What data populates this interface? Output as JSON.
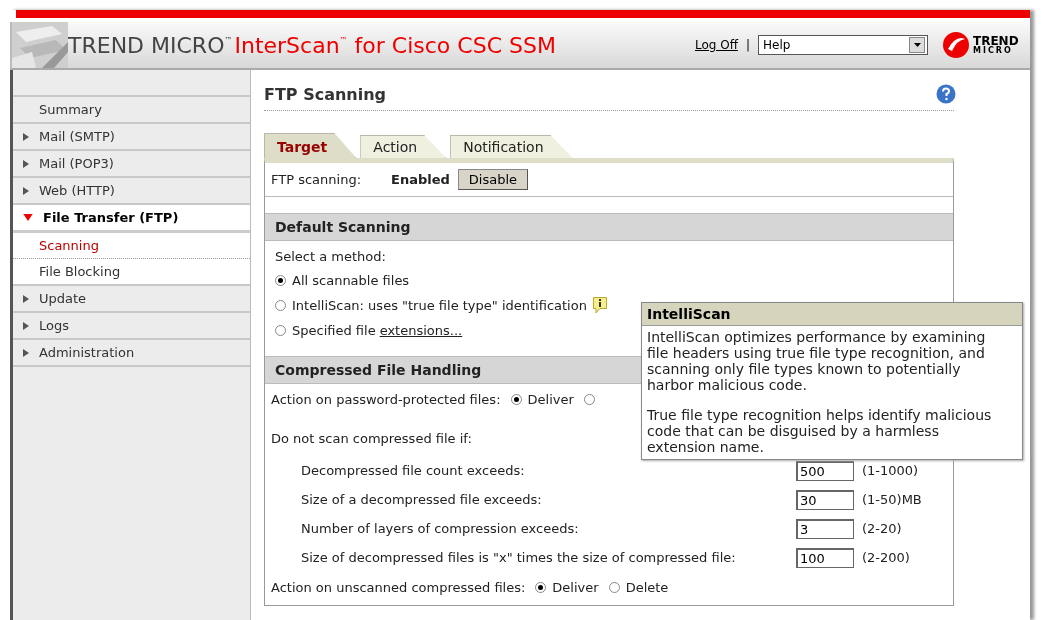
{
  "header": {
    "brand": "TREND MICRO",
    "brand_mark": "™",
    "product": "InterScan",
    "product_mark": "™",
    "product_suffix": "for Cisco CSC SSM",
    "logoff": "Log Off",
    "separator": "|",
    "help_select": {
      "value": "Help"
    },
    "logo_text": "TREND",
    "logo_subtext": "MICRO"
  },
  "sidebar": {
    "items": [
      {
        "label": "Summary",
        "kind": "plain",
        "expanded": false
      },
      {
        "label": "Mail (SMTP)",
        "kind": "section",
        "expanded": false
      },
      {
        "label": "Mail (POP3)",
        "kind": "section",
        "expanded": false
      },
      {
        "label": "Web (HTTP)",
        "kind": "section",
        "expanded": false
      },
      {
        "label": "File Transfer (FTP)",
        "kind": "section",
        "expanded": true,
        "children": [
          {
            "label": "Scanning",
            "selected": true
          },
          {
            "label": "File Blocking",
            "selected": false
          }
        ]
      },
      {
        "label": "Update",
        "kind": "section",
        "expanded": false
      },
      {
        "label": "Logs",
        "kind": "section",
        "expanded": false
      },
      {
        "label": "Administration",
        "kind": "section",
        "expanded": false
      }
    ]
  },
  "content": {
    "title": "FTP Scanning",
    "tabs": [
      {
        "label": "Target",
        "selected": true
      },
      {
        "label": "Action",
        "selected": false
      },
      {
        "label": "Notification",
        "selected": false
      }
    ],
    "status": {
      "label": "FTP scanning:",
      "value": "Enabled",
      "button": "Disable"
    },
    "default_scanning": {
      "heading": "Default Scanning",
      "prompt": "Select a method:",
      "options": [
        {
          "label": "All scannable files",
          "selected": true,
          "kind": "plain"
        },
        {
          "label": "IntelliScan: uses \"true file type\" identification",
          "selected": false,
          "kind": "info"
        },
        {
          "label": "Specified file",
          "link": "extensions...",
          "selected": false,
          "kind": "link"
        }
      ]
    },
    "compressed": {
      "heading": "Compressed File Handling",
      "password_row": {
        "label": "Action on password-protected files:",
        "options": [
          {
            "label": "Deliver",
            "selected": true
          },
          {
            "selected": false
          }
        ]
      },
      "limits_label": "Do not scan compressed file if:",
      "limits": [
        {
          "label": "Decompressed file count exceeds:",
          "value": "500",
          "range": "(1-1000)"
        },
        {
          "label": "Size of a decompressed file exceeds:",
          "value": "30",
          "range": "(1-50)MB"
        },
        {
          "label": "Number of layers of compression exceeds:",
          "value": "3",
          "range": "(2-20)"
        },
        {
          "label": "Size of decompressed files is \"x\" times the size of compressed file:",
          "value": "100",
          "range": "(2-200)"
        }
      ],
      "unscanned_row": {
        "label": "Action on unscanned compressed files:",
        "options": [
          {
            "label": "Deliver",
            "selected": true
          },
          {
            "label": "Delete",
            "selected": false
          }
        ]
      }
    }
  },
  "tooltip": {
    "title": "IntelliScan",
    "paragraphs": [
      "IntelliScan optimizes performance by examining file headers using true file type recognition, and scanning only file types known to potentially harbor malicious code.",
      "True file type recognition helps identify malicious code that can be disguised by a harmless extension name."
    ]
  }
}
